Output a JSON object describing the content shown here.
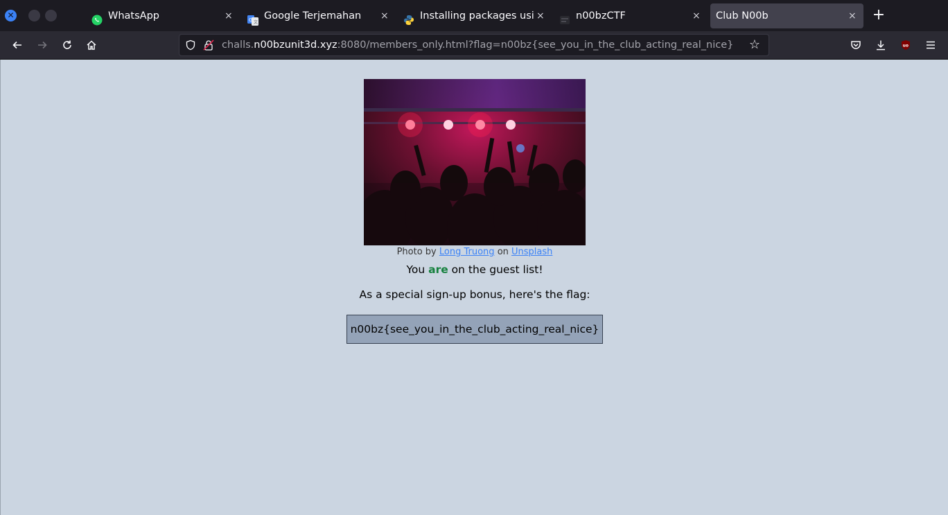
{
  "tabs": [
    {
      "title": "WhatsApp",
      "icon": "whatsapp-icon"
    },
    {
      "title": "Google Terjemahan",
      "icon": "google-translate-icon"
    },
    {
      "title": "Installing packages using p",
      "icon": "python-icon"
    },
    {
      "title": "n00bzCTF",
      "icon": "ctf-favicon-icon"
    },
    {
      "title": "Club N00b",
      "icon": "none",
      "active": true
    }
  ],
  "tab_close_glyph": "×",
  "new_tab_glyph": "+",
  "url": {
    "prefix": "challs.",
    "host": "n00bzunit3d.xyz",
    "rest": ":8080/members_only.html?flag=n00bz{see_you_in_the_club_acting_real_nice}"
  },
  "page": {
    "credit_prefix": "Photo by",
    "credit_author": "Long Truong",
    "credit_mid": "on",
    "credit_site": "Unsplash",
    "guest_pre": "You",
    "guest_em": "are",
    "guest_post": "on the guest list!",
    "bonus_text": "As a special sign-up bonus, here's the flag:",
    "flag": "n00bz{see_you_in_the_club_acting_real_nice}"
  },
  "colors": {
    "page_bg": "#cbd5e1",
    "flag_bg": "#94a3b8",
    "link": "#3b82f6",
    "are": "#15803d"
  }
}
